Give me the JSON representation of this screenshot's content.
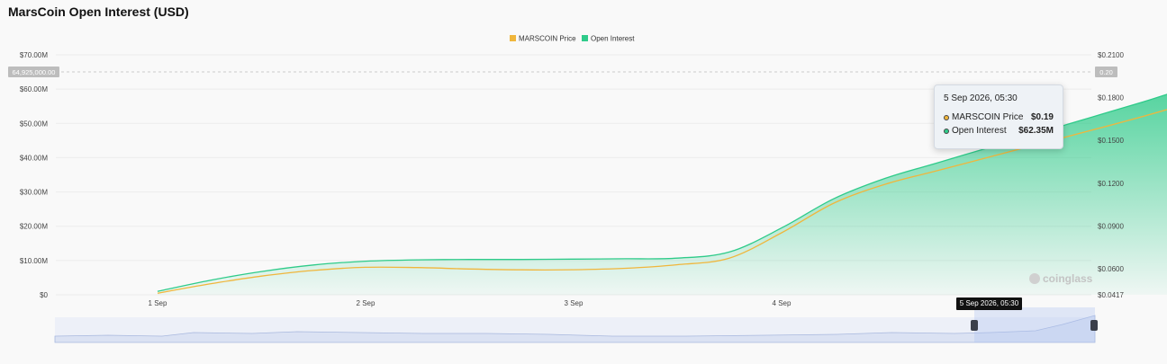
{
  "title": "MarsCoin Open Interest (USD)",
  "legend": [
    {
      "label": "MARSCOIN Price",
      "color": "#f0b63c"
    },
    {
      "label": "Open Interest",
      "color": "#2fcb8a"
    }
  ],
  "crosshair": {
    "left_value": "64,925,000.00",
    "right_value": "0.20",
    "x_label": "5 Sep 2026, 05:30"
  },
  "tooltip": {
    "date": "5 Sep 2026, 05:30",
    "rows": [
      {
        "name": "MARSCOIN Price",
        "value": "$0.19",
        "color": "#f0b63c"
      },
      {
        "name": "Open Interest",
        "value": "$62.35M",
        "color": "#2fcb8a"
      }
    ]
  },
  "watermark": "coinglass",
  "chart_data": {
    "type": "area",
    "x_ticks": [
      "1 Sep",
      "2 Sep",
      "3 Sep",
      "4 Sep"
    ],
    "y_left_ticks": [
      "$0",
      "$10.00M",
      "$20.00M",
      "$30.00M",
      "$40.00M",
      "$50.00M",
      "$60.00M",
      "$70.00M"
    ],
    "y_right_ticks": [
      "$0.0417",
      "$0.0600",
      "$0.0900",
      "$0.1200",
      "$0.1500",
      "$0.1800",
      "$0.2100"
    ],
    "y_left_range": [
      0,
      70000000
    ],
    "y_right_range": [
      0.0417,
      0.21
    ],
    "legend_position": "top-center",
    "series": [
      {
        "name": "Open Interest",
        "axis": "left",
        "color": "#2fcb8a",
        "x": [
          0,
          0.25,
          0.5,
          0.75,
          1.0,
          1.25,
          1.5,
          1.75,
          2.0,
          2.25,
          2.5,
          2.75,
          3.0,
          3.25,
          3.5,
          3.75,
          4.0,
          4.25,
          4.5,
          4.75,
          5.0,
          5.23
        ],
        "values": [
          1000000,
          4200000,
          6800000,
          8700000,
          9800000,
          10200000,
          10300000,
          10300000,
          10400000,
          10500000,
          10700000,
          12500000,
          19500000,
          28000000,
          34000000,
          38500000,
          43000000,
          47500000,
          52000000,
          56500000,
          61000000,
          62350000
        ]
      },
      {
        "name": "MARSCOIN Price",
        "axis": "right",
        "color": "#f0b63c",
        "x": [
          0,
          0.25,
          0.5,
          0.75,
          1.0,
          1.25,
          1.5,
          1.75,
          2.0,
          2.25,
          2.5,
          2.75,
          3.0,
          3.25,
          3.5,
          3.75,
          4.0,
          4.25,
          4.5,
          4.75,
          5.0,
          5.23
        ],
        "values": [
          0.0428,
          0.0493,
          0.0548,
          0.0588,
          0.061,
          0.0608,
          0.0598,
          0.0592,
          0.0593,
          0.0603,
          0.0628,
          0.0675,
          0.0852,
          0.1059,
          0.1193,
          0.1288,
          0.1384,
          0.1479,
          0.1575,
          0.1673,
          0.1778,
          0.187
        ]
      }
    ]
  }
}
